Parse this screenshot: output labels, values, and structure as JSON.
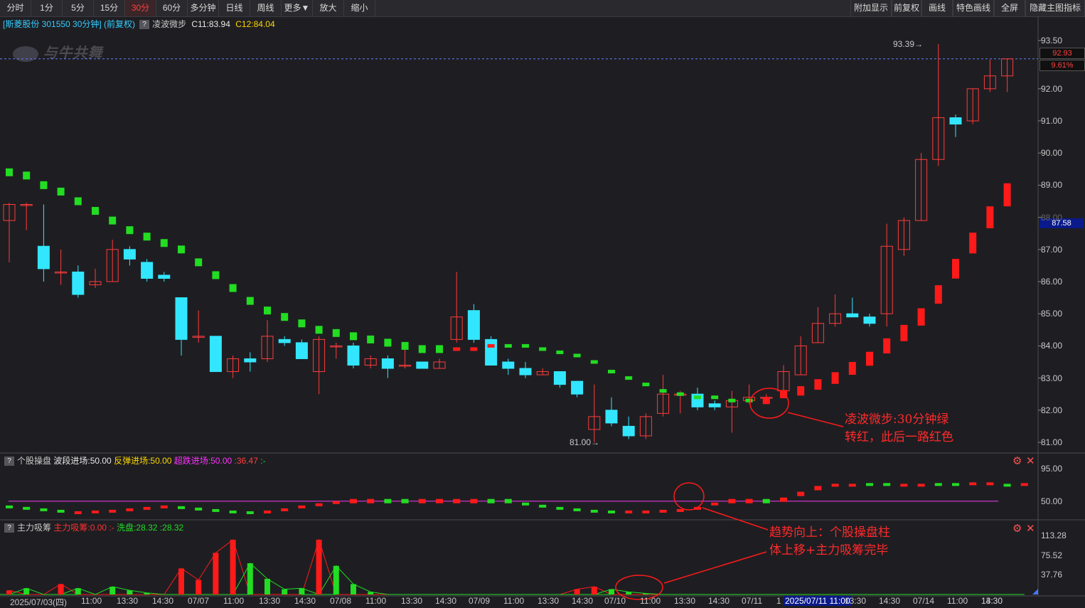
{
  "toolbar": {
    "left": [
      "分时",
      "1分",
      "5分",
      "15分",
      "30分",
      "60分",
      "多分钟",
      "日线",
      "周线",
      "更多▼",
      "放大",
      "缩小"
    ],
    "active": "30分",
    "right": [
      "附加显示",
      "前复权",
      "画线",
      "特色画线",
      "全屏",
      "隐藏主图指标"
    ]
  },
  "title": {
    "stock": "[斯菱股份 301550 30分钟] (前复权)",
    "indicator": "凌波微步",
    "c11": "C11:83.94",
    "c12": "C12:84.04"
  },
  "watermark": "与牛共舞",
  "main_axis": [
    "93.50",
    "92.00",
    "91.00",
    "90.00",
    "89.00",
    "88.00",
    "87.00",
    "86.00",
    "85.00",
    "84.00",
    "83.00",
    "82.00",
    "81.00"
  ],
  "price_boxes": {
    "current": "92.93",
    "pct": "9.61%",
    "cross": "87.58"
  },
  "markers": {
    "high": "93.39",
    "low": "81.00"
  },
  "panel2": {
    "name": "个股操盘",
    "wave": "波段进场:50.00",
    "rebound": "反弹进场:50.00",
    "oversold": "超跌进场:50.00",
    "val": ":36.47",
    "dash": ":-",
    "axis": [
      "95.00",
      "50.00"
    ]
  },
  "panel3": {
    "name": "主力吸筹",
    "main": "主力吸筹:0.00",
    "dash": ":-",
    "wash": "洗盘:28.32",
    "val": ":28.32",
    "axis": [
      "113.28",
      "75.52",
      "37.76"
    ]
  },
  "xaxis": [
    "2025/07/03(四)",
    "11:00",
    "13:30",
    "14:30",
    "07/07",
    "11:00",
    "13:30",
    "14:30",
    "07/08",
    "11:00",
    "13:30",
    "14:30",
    "07/09",
    "11:00",
    "13:30",
    "14:30",
    "07/10",
    "11:00",
    "13:30",
    "14:30",
    "07/11",
    "1",
    "2025/07/11 11:00",
    "13:30",
    "14:30",
    "07/14",
    "11:00",
    "13:30",
    "14:30"
  ],
  "annotations": {
    "a1": [
      "凌波微步:30分钟绿",
      "转红，此后一路红色"
    ],
    "a2": [
      "趋势向上：个股操盘柱",
      "体上移+主力吸筹完毕"
    ]
  },
  "colors": {
    "up": "#ff3b3b",
    "down": "#33e6ff",
    "green_dot": "#22dd22",
    "red_dot": "#ff1a1a",
    "purple_line": "#cc33cc",
    "bg": "#1e1e22"
  },
  "chart_data": [
    {
      "type": "candlestick",
      "title": "斯菱股份 301550 30分钟",
      "ylim": [
        80.8,
        93.8
      ],
      "candles": [
        {
          "o": 87.9,
          "c": 88.4,
          "h": 88.45,
          "l": 86.6
        },
        {
          "o": 88.4,
          "c": 88.4,
          "h": 88.45,
          "l": 87.6
        },
        {
          "o": 87.1,
          "c": 86.4,
          "h": 88.4,
          "l": 86.0
        },
        {
          "o": 86.3,
          "c": 86.3,
          "h": 87.0,
          "l": 85.9
        },
        {
          "o": 86.3,
          "c": 85.6,
          "h": 86.5,
          "l": 85.5
        },
        {
          "o": 85.9,
          "c": 86.0,
          "h": 86.4,
          "l": 85.8
        },
        {
          "o": 86.0,
          "c": 87.0,
          "h": 87.3,
          "l": 86.0
        },
        {
          "o": 87.0,
          "c": 86.7,
          "h": 87.1,
          "l": 86.5
        },
        {
          "o": 86.6,
          "c": 86.1,
          "h": 86.7,
          "l": 86.0
        },
        {
          "o": 86.2,
          "c": 86.1,
          "h": 86.3,
          "l": 86.0
        },
        {
          "o": 85.5,
          "c": 84.2,
          "h": 85.5,
          "l": 83.7
        },
        {
          "o": 84.3,
          "c": 84.3,
          "h": 85.1,
          "l": 84.1
        },
        {
          "o": 84.3,
          "c": 83.2,
          "h": 84.3,
          "l": 83.2
        },
        {
          "o": 83.2,
          "c": 83.6,
          "h": 83.7,
          "l": 83.0
        },
        {
          "o": 83.6,
          "c": 83.5,
          "h": 83.8,
          "l": 83.2
        },
        {
          "o": 83.6,
          "c": 84.3,
          "h": 84.8,
          "l": 83.5
        },
        {
          "o": 84.2,
          "c": 84.1,
          "h": 84.3,
          "l": 84.0
        },
        {
          "o": 84.1,
          "c": 83.6,
          "h": 84.2,
          "l": 83.6
        },
        {
          "o": 83.2,
          "c": 84.2,
          "h": 84.3,
          "l": 82.5
        },
        {
          "o": 84.0,
          "c": 84.0,
          "h": 84.1,
          "l": 83.6
        },
        {
          "o": 84.0,
          "c": 83.4,
          "h": 84.1,
          "l": 83.3
        },
        {
          "o": 83.4,
          "c": 83.6,
          "h": 83.7,
          "l": 83.3
        },
        {
          "o": 83.6,
          "c": 83.3,
          "h": 83.7,
          "l": 83.0
        },
        {
          "o": 83.4,
          "c": 83.4,
          "h": 83.9,
          "l": 83.3
        },
        {
          "o": 83.5,
          "c": 83.3,
          "h": 83.5,
          "l": 83.3
        },
        {
          "o": 83.3,
          "c": 83.5,
          "h": 83.6,
          "l": 83.3
        },
        {
          "o": 84.2,
          "c": 84.9,
          "h": 86.3,
          "l": 84.1
        },
        {
          "o": 85.1,
          "c": 84.2,
          "h": 85.3,
          "l": 84.1
        },
        {
          "o": 84.2,
          "c": 83.4,
          "h": 84.3,
          "l": 83.4
        },
        {
          "o": 83.5,
          "c": 83.3,
          "h": 83.6,
          "l": 83.1
        },
        {
          "o": 83.3,
          "c": 83.1,
          "h": 83.5,
          "l": 83.0
        },
        {
          "o": 83.1,
          "c": 83.2,
          "h": 83.3,
          "l": 83.1
        },
        {
          "o": 83.2,
          "c": 82.8,
          "h": 83.2,
          "l": 82.7
        },
        {
          "o": 82.9,
          "c": 82.5,
          "h": 82.9,
          "l": 82.4
        },
        {
          "o": 81.4,
          "c": 81.8,
          "h": 82.8,
          "l": 81.0
        },
        {
          "o": 82.0,
          "c": 81.6,
          "h": 82.4,
          "l": 81.5
        },
        {
          "o": 81.5,
          "c": 81.2,
          "h": 81.8,
          "l": 81.1
        },
        {
          "o": 81.2,
          "c": 81.8,
          "h": 81.9,
          "l": 81.1
        },
        {
          "o": 81.9,
          "c": 82.5,
          "h": 83.1,
          "l": 81.8
        },
        {
          "o": 82.5,
          "c": 82.5,
          "h": 82.6,
          "l": 81.9
        },
        {
          "o": 82.5,
          "c": 82.1,
          "h": 82.7,
          "l": 82.0
        },
        {
          "o": 82.2,
          "c": 82.1,
          "h": 82.3,
          "l": 82.0
        },
        {
          "o": 82.1,
          "c": 82.3,
          "h": 82.6,
          "l": 81.3
        },
        {
          "o": 82.3,
          "c": 82.4,
          "h": 82.8,
          "l": 82.2
        },
        {
          "o": 82.4,
          "c": 82.4,
          "h": 82.5,
          "l": 82.3
        },
        {
          "o": 82.6,
          "c": 83.2,
          "h": 83.4,
          "l": 82.6
        },
        {
          "o": 83.1,
          "c": 84.0,
          "h": 84.3,
          "l": 83.1
        },
        {
          "o": 84.1,
          "c": 84.7,
          "h": 85.2,
          "l": 84.1
        },
        {
          "o": 84.7,
          "c": 85.0,
          "h": 85.6,
          "l": 84.6
        },
        {
          "o": 85.0,
          "c": 84.9,
          "h": 85.5,
          "l": 84.9
        },
        {
          "o": 84.9,
          "c": 84.7,
          "h": 85.0,
          "l": 84.6
        },
        {
          "o": 85.0,
          "c": 87.1,
          "h": 87.8,
          "l": 84.6
        },
        {
          "o": 87.0,
          "c": 87.9,
          "h": 88.0,
          "l": 86.8
        },
        {
          "o": 87.9,
          "c": 89.8,
          "h": 90.0,
          "l": 87.9
        },
        {
          "o": 89.8,
          "c": 91.1,
          "h": 93.39,
          "l": 89.6
        },
        {
          "o": 91.1,
          "c": 90.9,
          "h": 91.2,
          "l": 90.5
        },
        {
          "o": 91.0,
          "c": 92.0,
          "h": 92.0,
          "l": 90.9
        },
        {
          "o": 92.0,
          "c": 92.4,
          "h": 92.9,
          "l": 91.9
        },
        {
          "o": 92.4,
          "c": 92.93,
          "h": 92.93,
          "l": 91.9
        }
      ],
      "lbwb": [
        {
          "v": 89.4,
          "t": "g"
        },
        {
          "v": 89.3,
          "t": "g"
        },
        {
          "v": 89.0,
          "t": "g"
        },
        {
          "v": 88.8,
          "t": "g"
        },
        {
          "v": 88.5,
          "t": "g"
        },
        {
          "v": 88.2,
          "t": "g"
        },
        {
          "v": 87.9,
          "t": "g"
        },
        {
          "v": 87.6,
          "t": "g"
        },
        {
          "v": 87.4,
          "t": "g"
        },
        {
          "v": 87.2,
          "t": "g"
        },
        {
          "v": 87.0,
          "t": "g"
        },
        {
          "v": 86.6,
          "t": "g"
        },
        {
          "v": 86.2,
          "t": "g"
        },
        {
          "v": 85.8,
          "t": "g"
        },
        {
          "v": 85.4,
          "t": "g"
        },
        {
          "v": 85.1,
          "t": "g"
        },
        {
          "v": 84.9,
          "t": "g"
        },
        {
          "v": 84.7,
          "t": "g"
        },
        {
          "v": 84.5,
          "t": "g"
        },
        {
          "v": 84.4,
          "t": "g"
        },
        {
          "v": 84.3,
          "t": "g"
        },
        {
          "v": 84.2,
          "t": "g"
        },
        {
          "v": 84.1,
          "t": "g"
        },
        {
          "v": 84.0,
          "t": "g"
        },
        {
          "v": 83.9,
          "t": "g"
        },
        {
          "v": 83.9,
          "t": "g"
        },
        {
          "v": 83.9,
          "t": "r"
        },
        {
          "v": 83.9,
          "t": "r"
        },
        {
          "v": 84.0,
          "t": "r"
        },
        {
          "v": 84.0,
          "t": "g"
        },
        {
          "v": 84.0,
          "t": "g"
        },
        {
          "v": 83.9,
          "t": "g"
        },
        {
          "v": 83.8,
          "t": "g"
        },
        {
          "v": 83.7,
          "t": "g"
        },
        {
          "v": 83.5,
          "t": "g"
        },
        {
          "v": 83.2,
          "t": "g"
        },
        {
          "v": 83.0,
          "t": "g"
        },
        {
          "v": 82.8,
          "t": "g"
        },
        {
          "v": 82.6,
          "t": "g"
        },
        {
          "v": 82.5,
          "t": "g"
        },
        {
          "v": 82.4,
          "t": "g"
        },
        {
          "v": 82.4,
          "t": "g"
        },
        {
          "v": 82.3,
          "t": "g"
        },
        {
          "v": 82.3,
          "t": "g"
        },
        {
          "v": 82.3,
          "t": "r"
        },
        {
          "v": 82.5,
          "t": "r"
        },
        {
          "v": 82.6,
          "t": "r"
        },
        {
          "v": 82.8,
          "t": "r"
        },
        {
          "v": 83.0,
          "t": "r"
        },
        {
          "v": 83.3,
          "t": "r"
        },
        {
          "v": 83.6,
          "t": "r"
        },
        {
          "v": 84.0,
          "t": "r"
        },
        {
          "v": 84.4,
          "t": "r"
        },
        {
          "v": 84.9,
          "t": "r"
        },
        {
          "v": 85.6,
          "t": "r"
        },
        {
          "v": 86.4,
          "t": "r"
        },
        {
          "v": 87.2,
          "t": "r"
        },
        {
          "v": 88.0,
          "t": "r"
        },
        {
          "v": 88.7,
          "t": "r"
        }
      ]
    },
    {
      "type": "bar",
      "title": "个股操盘",
      "ylim": [
        30,
        105
      ],
      "values": [
        42,
        40,
        38,
        36,
        34,
        35,
        36,
        38,
        40,
        42,
        41,
        39,
        37,
        35,
        34,
        35,
        38,
        42,
        45,
        48,
        50,
        50,
        50,
        50,
        50,
        50,
        50,
        50,
        50,
        50,
        46,
        43,
        40,
        38,
        36,
        35,
        35,
        35,
        36,
        37,
        40,
        46,
        50,
        50,
        50,
        52,
        60,
        68,
        72,
        72,
        73,
        73,
        72,
        72,
        73,
        73,
        74,
        74,
        72,
        73
      ],
      "colors": [
        "g",
        "g",
        "g",
        "g",
        "r",
        "r",
        "r",
        "r",
        "r",
        "r",
        "g",
        "g",
        "g",
        "g",
        "g",
        "r",
        "r",
        "r",
        "r",
        "r",
        "r",
        "r",
        "g",
        "g",
        "r",
        "r",
        "r",
        "r",
        "g",
        "g",
        "g",
        "g",
        "g",
        "g",
        "g",
        "g",
        "r",
        "r",
        "r",
        "r",
        "r",
        "r",
        "r",
        "r",
        "g",
        "r",
        "r",
        "r",
        "r",
        "r",
        "g",
        "g",
        "r",
        "r",
        "g",
        "g",
        "r",
        "r",
        "g",
        "r"
      ]
    },
    {
      "type": "bar",
      "title": "主力吸筹",
      "ylim": [
        0,
        120
      ],
      "main": [
        8,
        0,
        0,
        20,
        0,
        0,
        0,
        0,
        0,
        0,
        50,
        28,
        80,
        105,
        0,
        0,
        0,
        0,
        105,
        0,
        0,
        0,
        0,
        0,
        0,
        0,
        0,
        0,
        0,
        0,
        0,
        0,
        0,
        10,
        15,
        0,
        0,
        0,
        0,
        0,
        0,
        0,
        0,
        0,
        0,
        0,
        0,
        0,
        0,
        0,
        0,
        0,
        0,
        0,
        0,
        0,
        0,
        0,
        0,
        0
      ],
      "wash": [
        0,
        12,
        0,
        0,
        12,
        0,
        15,
        8,
        3,
        0,
        0,
        0,
        0,
        0,
        60,
        30,
        10,
        12,
        0,
        55,
        20,
        5,
        0,
        0,
        0,
        0,
        0,
        0,
        0,
        0,
        0,
        0,
        0,
        0,
        0,
        10,
        5,
        2,
        0,
        0,
        0,
        0,
        0,
        0,
        0,
        0,
        0,
        0,
        0,
        0,
        0,
        0,
        0,
        0,
        0,
        0,
        0,
        0,
        0,
        0
      ]
    }
  ]
}
